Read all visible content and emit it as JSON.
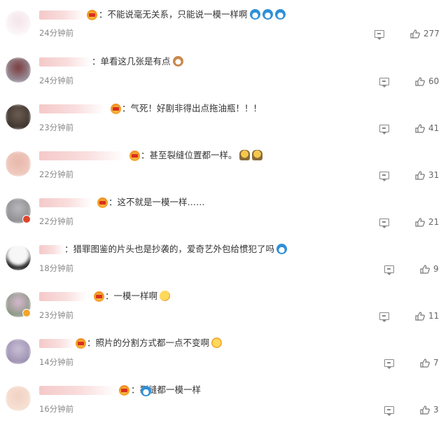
{
  "colors": {
    "text": "#333333",
    "time": "#888888",
    "icon": "#888888",
    "badge_gold": "#f2a52a",
    "badge_red": "#e0452c"
  },
  "comments": [
    {
      "text": "：不能说毫无关系，只能说一模一样啊",
      "emojis": [
        "doraemon",
        "doraemon",
        "doraemon"
      ],
      "time": "24分钟前",
      "likes": "277",
      "avatar_colors": [
        "#f4e3e8",
        "#ffffff"
      ],
      "badge": null
    },
    {
      "text": "：单看这几张是有点",
      "emojis": [
        "cat"
      ],
      "time": "24分钟前",
      "likes": "60",
      "avatar_colors": [
        "#7a3a3a",
        "#a8b6c8"
      ],
      "badge": null
    },
    {
      "text": "：气死！好剧非得出点拖油瓶！！！",
      "emojis": [],
      "time": "23分钟前",
      "likes": "41",
      "avatar_colors": [
        "#2b2320",
        "#6d5e52"
      ],
      "badge": null
    },
    {
      "text": "：甚至裂缝位置都一样。",
      "emojis": [
        "thumb",
        "thumb"
      ],
      "time": "22分钟前",
      "likes": "31",
      "avatar_colors": [
        "#e8b7aa",
        "#f3d2c8"
      ],
      "badge": null
    },
    {
      "text": "：这不就是一模一样……",
      "emojis": [],
      "time": "22分钟前",
      "likes": "21",
      "avatar_colors": [
        "#7d7d80",
        "#b9b9bd"
      ],
      "badge": "red"
    },
    {
      "text": "：猎罪图鉴的片头也是抄袭的，爱奇艺外包给惯犯了吗",
      "emojis": [
        "doraemon"
      ],
      "time": "18分钟前",
      "likes": "9",
      "avatar_colors": [
        "#f2f2f2",
        "#2e2e2e"
      ],
      "badge": null
    },
    {
      "text": "：一模一样啊",
      "emojis": [
        "think"
      ],
      "time": "23分钟前",
      "likes": "11",
      "avatar_colors": [
        "#d9b9d3",
        "#6b8a62"
      ],
      "badge": "gold"
    },
    {
      "text": "：照片的分割方式都一点不变啊",
      "emojis": [
        "laugh"
      ],
      "time": "14分钟前",
      "likes": "7",
      "avatar_colors": [
        "#8c7ea3",
        "#c8c0d6"
      ],
      "badge": null
    },
    {
      "text": "：裂缝都一模一样",
      "emojis_before": [
        "doraemon"
      ],
      "emojis": [],
      "time": "16分钟前",
      "likes": "3",
      "avatar_colors": [
        "#f1d2c3",
        "#f9e6db"
      ],
      "badge": null
    }
  ]
}
